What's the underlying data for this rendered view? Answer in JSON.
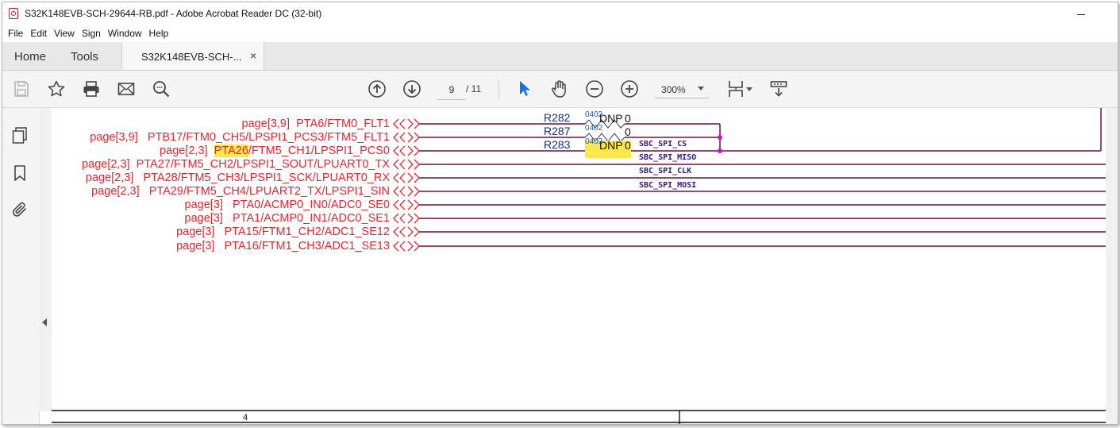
{
  "window": {
    "title": "S32K148EVB-SCH-29644-RB.pdf - Adobe Acrobat Reader DC (32-bit)"
  },
  "menu": [
    "File",
    "Edit",
    "View",
    "Sign",
    "Window",
    "Help"
  ],
  "tabs": {
    "home": "Home",
    "tools": "Tools",
    "document": "S32K148EVB-SCH-...",
    "close": "×"
  },
  "toolbar": {
    "page_current": "9",
    "page_total": "/ 11",
    "zoom": "300%"
  },
  "schematic": {
    "signals": [
      {
        "page": "page[3,9]",
        "highlight": "",
        "name": "PTA6/FTM0_FLT1"
      },
      {
        "page": "page[3,9]",
        "highlight": "",
        "name": "PTB17/FTM0_CH5/LPSPI1_PCS3/FTM5_FLT1"
      },
      {
        "page": "page[2,3]",
        "highlight": "PTA26",
        "name": "/FTM5_CH1/LPSPI1_PCS0"
      },
      {
        "page": "page[2,3]",
        "highlight": "",
        "name": "PTA27/FTM5_CH2/LPSPI1_SOUT/LPUART0_TX"
      },
      {
        "page": "page[2,3]",
        "highlight": "",
        "name": "PTA28/FTM5_CH3/LPSPI1_SCK/LPUART0_RX"
      },
      {
        "page": "page[2,3]",
        "highlight": "",
        "name": "PTA29/FTM5_CH4/LPUART2_TX/LPSPI1_SIN"
      },
      {
        "page": "page[3]",
        "highlight": "",
        "name": "PTA0/ACMP0_IN0/ADC0_SE0"
      },
      {
        "page": "page[3]",
        "highlight": "",
        "name": "PTA1/ACMP0_IN1/ADC0_SE1"
      },
      {
        "page": "page[3]",
        "highlight": "",
        "name": "PTA15/FTM1_CH2/ADC1_SE12"
      },
      {
        "page": "page[3]",
        "highlight": "",
        "name": "PTA16/FTM1_CH3/ADC1_SE13"
      }
    ],
    "resistors": [
      {
        "ref": "R282",
        "pkg": "0402",
        "value": "DNP",
        "ohm": "0"
      },
      {
        "ref": "R287",
        "pkg": "0402",
        "value": "",
        "ohm": "0"
      },
      {
        "ref": "R283",
        "pkg": "0402",
        "value": "DNP",
        "ohm": "0"
      }
    ],
    "nets": [
      "SBC_SPI_CS",
      "SBC_SPI_MISO",
      "SBC_SPI_CLK",
      "SBC_SPI_MOSI"
    ],
    "frame_number": "4"
  },
  "colors": {
    "label": "#e8232b",
    "wire": "#6e0e3c",
    "highlight": "#fde74c",
    "junction": "#e000e0"
  }
}
